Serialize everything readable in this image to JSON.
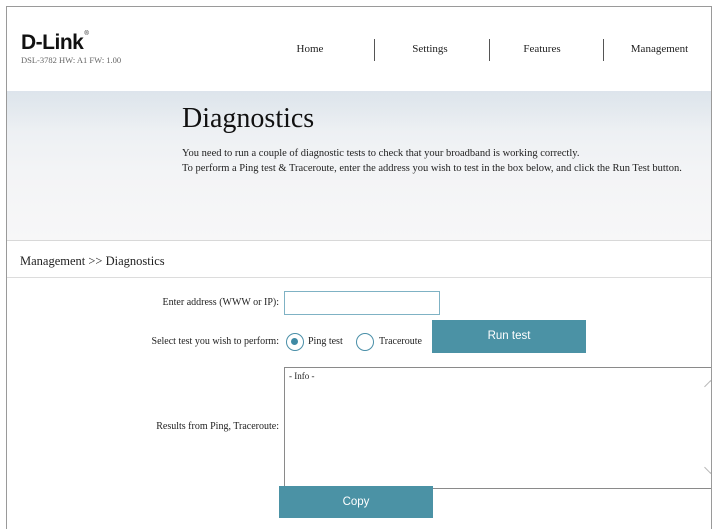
{
  "header": {
    "brand": "D-Link",
    "brand_mark": "®",
    "model_info": "DSL-3782  HW: A1  FW: 1.00",
    "nav": [
      "Home",
      "Settings",
      "Features",
      "Management"
    ]
  },
  "banner": {
    "title": "Diagnostics",
    "line1": "You need to run a couple of diagnostic tests to check that your broadband is working correctly.",
    "line2": "To perform a Ping test & Traceroute, enter the address you wish to test in the box below, and click the Run Test button."
  },
  "breadcrumb": "Management >> Diagnostics",
  "form": {
    "address_label": "Enter address (WWW or IP):",
    "address_value": "",
    "test_label": "Select test you wish to perform:",
    "ping_label": "Ping test",
    "traceroute_label": "Traceroute",
    "selected_test": "Ping test",
    "run_button": "Run test",
    "results_label": "Results from Ping, Traceroute:",
    "results_text": "- Info -",
    "copy_button": "Copy"
  },
  "colors": {
    "accent": "#4b92a5",
    "input_border": "#7fb2c4"
  }
}
